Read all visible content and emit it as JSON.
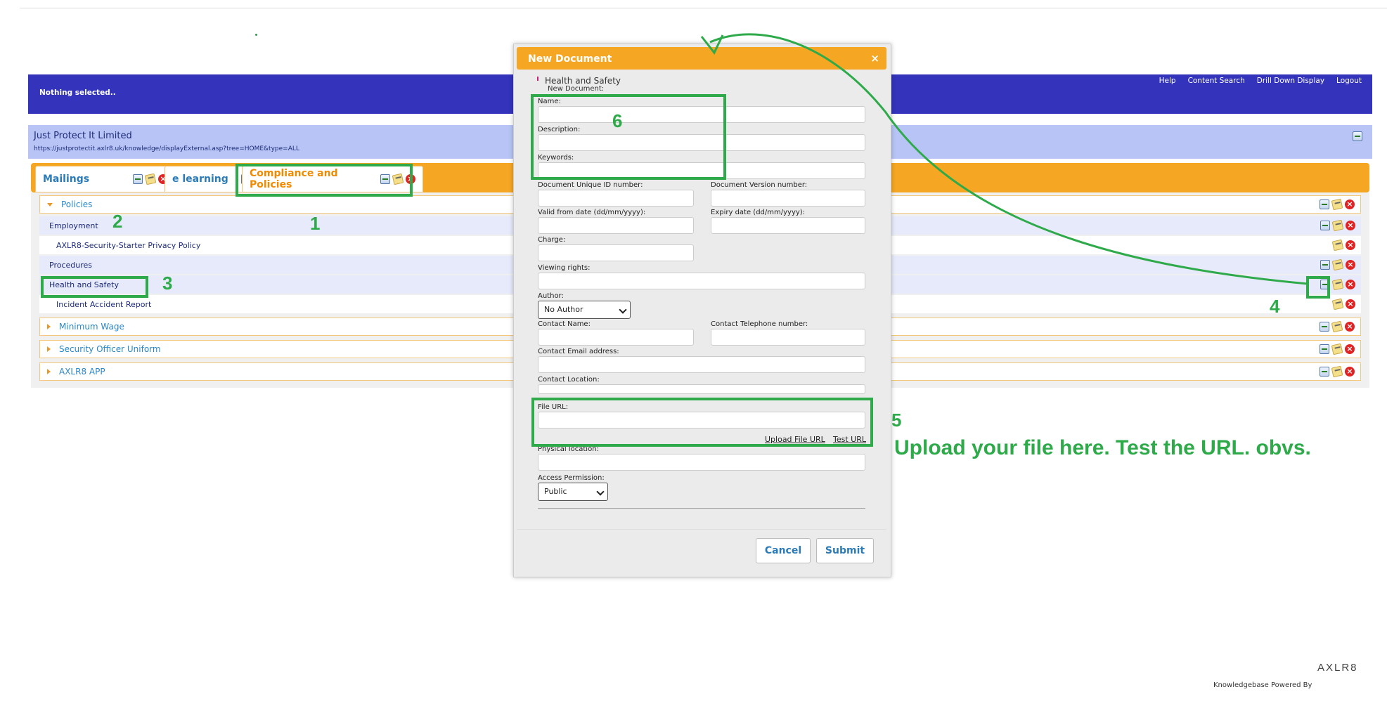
{
  "status_text": "Nothing selected..",
  "top_links": [
    "Help",
    "Content Search",
    "Drill Down Display",
    "Logout"
  ],
  "company": {
    "name": "Just Protect It Limited",
    "url": "https://justprotectit.axlr8.uk/knowledge/displayExternal.asp?tree=HOME&type=ALL"
  },
  "tabs": [
    {
      "label": "Mailings",
      "active": false
    },
    {
      "label": "e learning",
      "active": false
    },
    {
      "label": "Compliance and Policies",
      "active": true
    }
  ],
  "tree": {
    "policies": "Policies",
    "employment": "Employment",
    "privacy_policy": "AXLR8-Security-Starter Privacy Policy",
    "procedures": "Procedures",
    "health_safety": "Health and Safety",
    "incident": "Incident Accident Report",
    "minimum_wage": "Minimum Wage",
    "uniform": "Security Officer Uniform",
    "app": "AXLR8 APP"
  },
  "modal": {
    "title": "New Document",
    "close": "×",
    "context": "Health and Safety",
    "subtitle": "New Document:",
    "labels": {
      "name": "Name:",
      "description": "Description:",
      "keywords": "Keywords:",
      "doc_id": "Document Unique ID number:",
      "doc_version": "Document Version number:",
      "valid_from": "Valid from date (dd/mm/yyyy):",
      "expiry": "Expiry date (dd/mm/yyyy):",
      "charge": "Charge:",
      "viewing_rights": "Viewing rights:",
      "author": "Author:",
      "contact_name": "Contact Name:",
      "contact_phone": "Contact Telephone number:",
      "contact_email": "Contact Email address:",
      "contact_location": "Contact Location:",
      "file_url": "File URL:",
      "physical_location": "Physical location:",
      "access_permission": "Access Permission:"
    },
    "author_value": "No Author",
    "access_value": "Public",
    "upload_link": "Upload File URL",
    "test_link": "Test URL",
    "cancel": "Cancel",
    "submit": "Submit"
  },
  "annotations": {
    "n1": "1",
    "n2": "2",
    "n3": "3",
    "n4": "4",
    "n5": "5",
    "n6": "6",
    "upload_note": "Upload your file here.  Test the URL. obvs.",
    "color": "#2eaa4a"
  },
  "footer": {
    "powered_by": "Knowledgebase Powered By",
    "logo_text": "AXLR8"
  }
}
